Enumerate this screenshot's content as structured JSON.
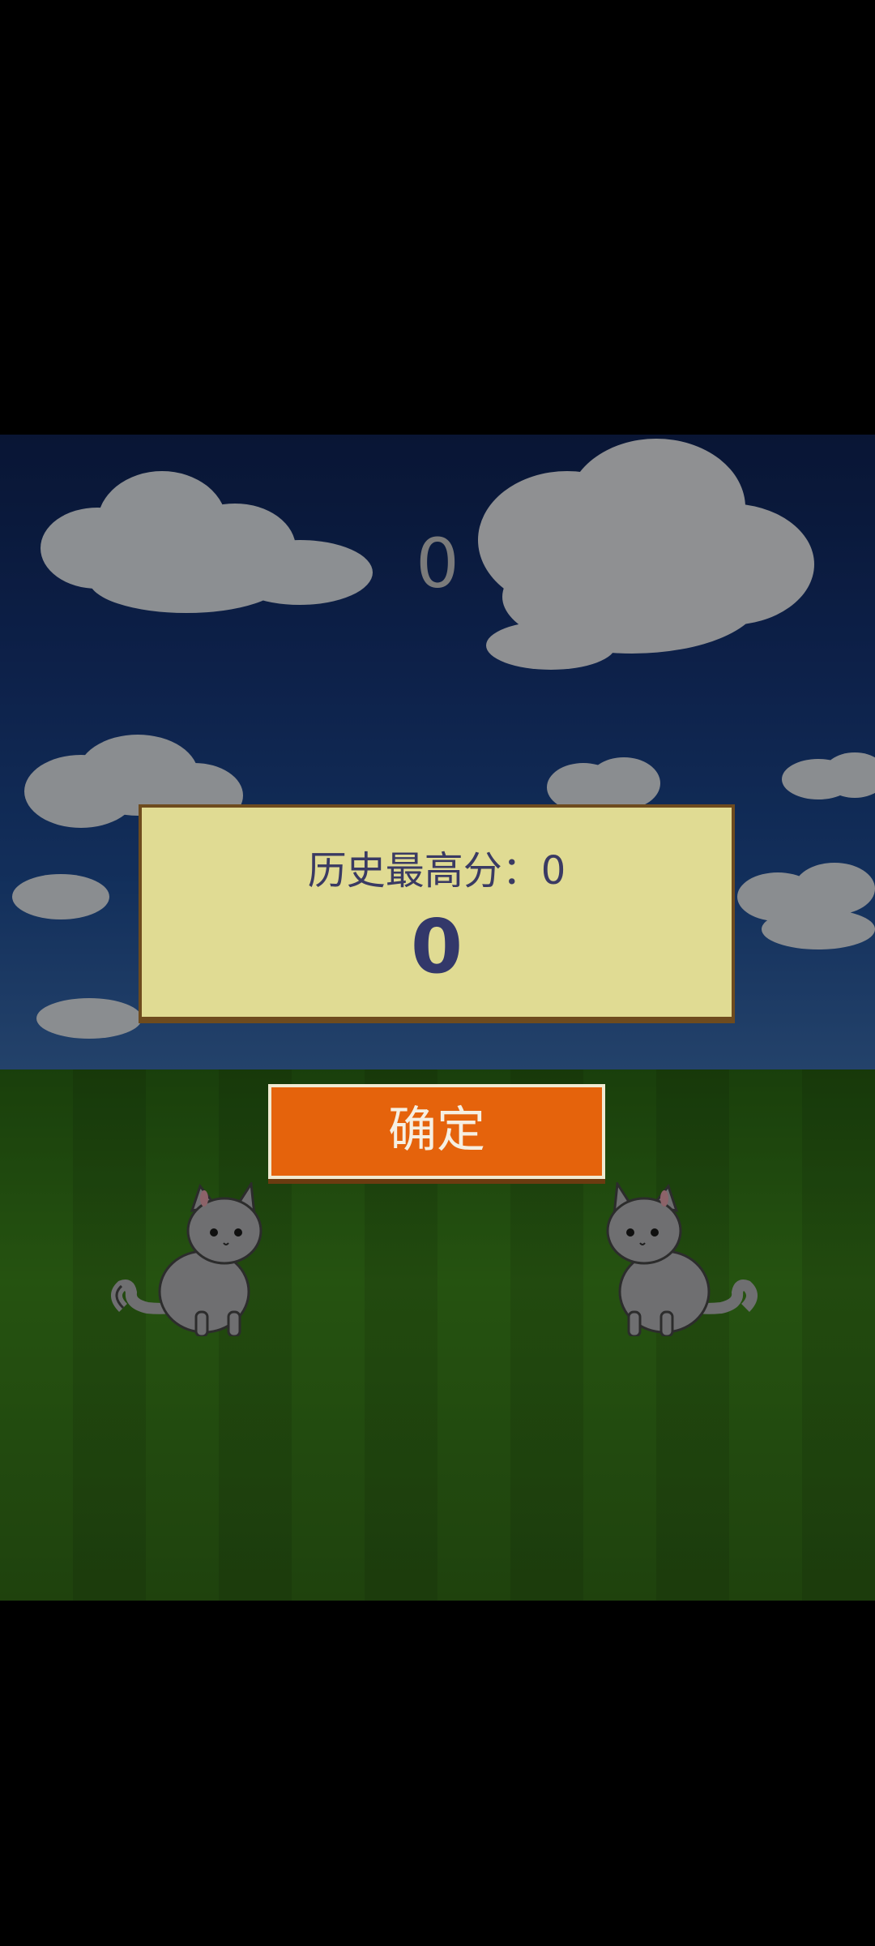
{
  "game": {
    "current_score": "0",
    "result_panel": {
      "best_score_text": "历史最高分：0",
      "final_score": "0"
    },
    "confirm_button": {
      "label": "确定"
    },
    "colors": {
      "panel_bg": "#e0db93",
      "panel_border": "#6e4b1e",
      "button_bg": "#e5630c",
      "button_text": "#f6efe2",
      "score_text": "#33386a"
    },
    "decorations": {
      "left_character": "cat-icon",
      "right_character": "cat-icon",
      "background": "sky-and-grass"
    }
  }
}
